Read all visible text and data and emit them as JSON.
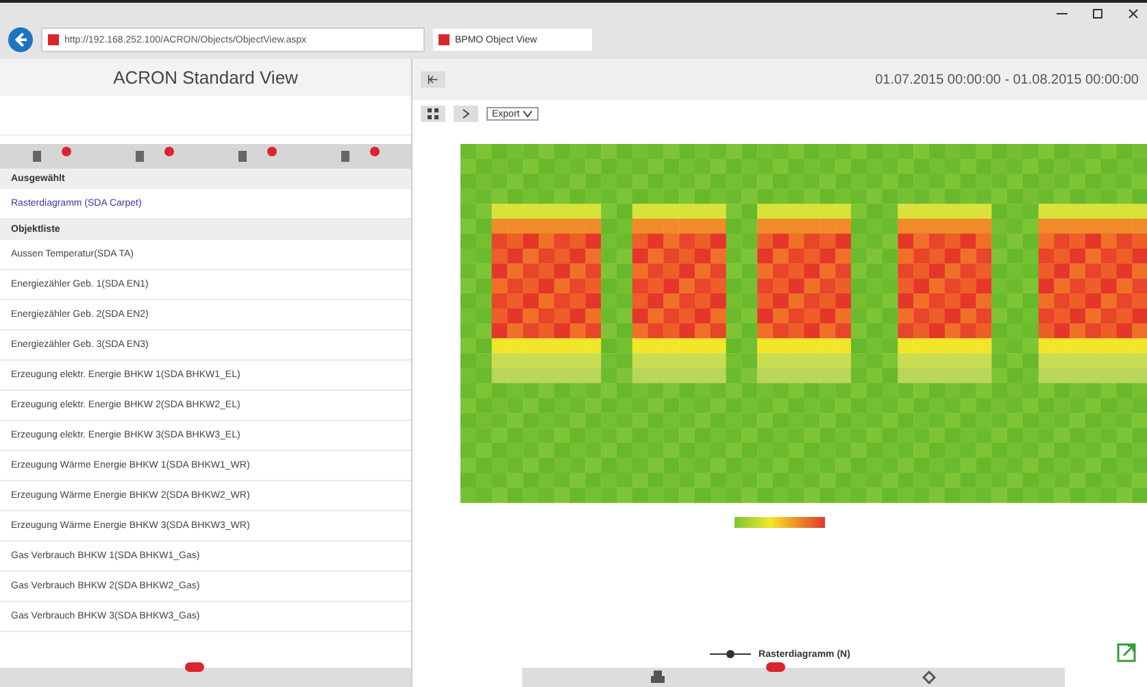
{
  "browser": {
    "address": "http://192.168.252.100/ACRON/Objects/ObjectView.aspx",
    "tab_title": "BPMO Object View"
  },
  "left_panel": {
    "title": "ACRON Standard View",
    "selected_header": "Ausgewählt",
    "selected_items": [
      {
        "label": "Rasterdiagramm (SDA Carpet)"
      }
    ],
    "list_header": "Objektliste",
    "objects": [
      {
        "label": "Aussen Temperatur(SDA TA)"
      },
      {
        "label": "Energiezähler Geb. 1(SDA EN1)"
      },
      {
        "label": "Energiezähler Geb. 2(SDA EN2)"
      },
      {
        "label": "Energiezähler Geb. 3(SDA EN3)"
      },
      {
        "label": "Erzeugung elektr. Energie BHKW 1(SDA BHKW1_EL)"
      },
      {
        "label": "Erzeugung elektr. Energie BHKW 2(SDA BHKW2_EL)"
      },
      {
        "label": "Erzeugung elektr. Energie BHKW 3(SDA BHKW3_EL)"
      },
      {
        "label": "Erzeugung Wärme Energie BHKW 1(SDA BHKW1_WR)"
      },
      {
        "label": "Erzeugung Wärme Energie BHKW 2(SDA BHKW2_WR)"
      },
      {
        "label": "Erzeugung Wärme Energie BHKW 3(SDA BHKW3_WR)"
      },
      {
        "label": "Gas Verbrauch BHKW 1(SDA BHKW1_Gas)"
      },
      {
        "label": "Gas Verbrauch BHKW 2(SDA BHKW2_Gas)"
      },
      {
        "label": "Gas Verbrauch BHKW 3(SDA BHKW3_Gas)"
      }
    ]
  },
  "right_panel": {
    "date_range": "01.07.2015 00:00:00 - 01.08.2015 00:00:00",
    "export_label": "Export",
    "legend_label": "Rasterdiagramm (N)"
  }
}
